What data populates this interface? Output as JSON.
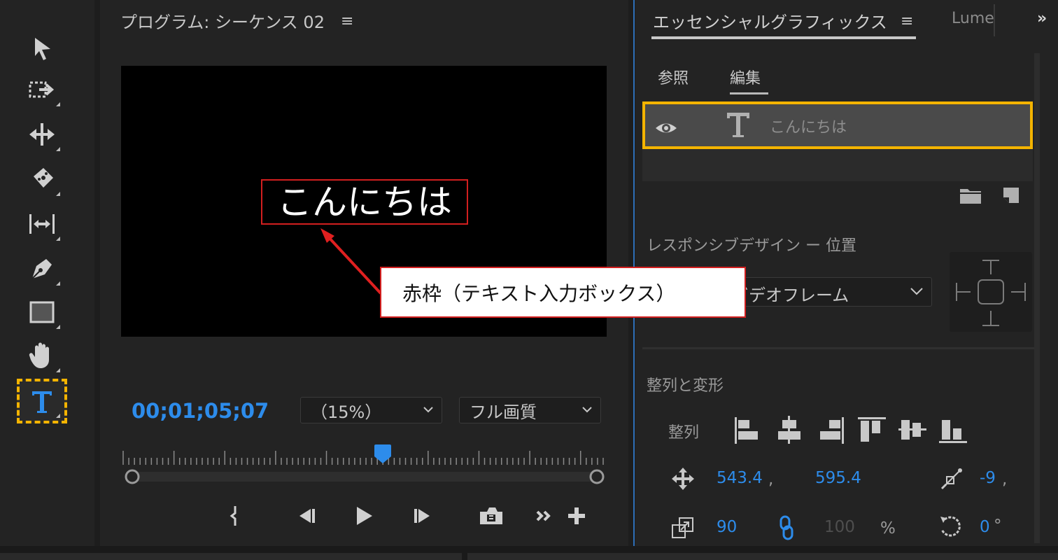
{
  "tools": [
    {
      "name": "selection-tool",
      "icon": "arrow-pointer-icon"
    },
    {
      "name": "track-select-forward-tool",
      "icon": "track-select-icon"
    },
    {
      "name": "ripple-edit-tool",
      "icon": "ripple-edit-icon"
    },
    {
      "name": "razor-tool",
      "icon": "razor-icon"
    },
    {
      "name": "slip-tool",
      "icon": "slip-icon"
    },
    {
      "name": "pen-tool",
      "icon": "pen-icon"
    },
    {
      "name": "rectangle-tool",
      "icon": "rectangle-icon"
    },
    {
      "name": "hand-tool",
      "icon": "hand-icon"
    },
    {
      "name": "type-tool",
      "icon": "type-icon",
      "selected": true
    }
  ],
  "monitor": {
    "title": "プログラム: シーケンス 02",
    "menu_icon": "≡",
    "video_text": "こんにちは",
    "timecode": "00;01;05;07",
    "zoom": "（15%）",
    "quality": "フル画質",
    "playhead_position": 0.54
  },
  "essential_graphics": {
    "title": "エッセンシャルグラフィックス",
    "menu_icon": "≡",
    "next_tab": "Lume",
    "overflow": "»",
    "tabs": {
      "browse": "参照",
      "edit": "編集"
    },
    "layer": {
      "name": "こんにちは",
      "visible": true
    },
    "responsive_label": "レスポンシブデザイン ー 位置",
    "pin_to_value": "ビデオフレーム",
    "align_section_label": "整列と変形",
    "align_label": "整列",
    "position": {
      "x": "543.4",
      "y": "595.4",
      "sep": ","
    },
    "anchor": {
      "value": "-9",
      "sep": ","
    },
    "scale": {
      "value": "90",
      "height": "100",
      "unit": "%"
    },
    "rotation": {
      "value": "0",
      "unit": "°"
    }
  },
  "callout": {
    "text": "赤枠（テキスト入力ボックス）"
  },
  "colors": {
    "accent_blue": "#2d8ceb",
    "highlight_yellow": "#f4b400",
    "annotation_red": "#d21f1f"
  }
}
